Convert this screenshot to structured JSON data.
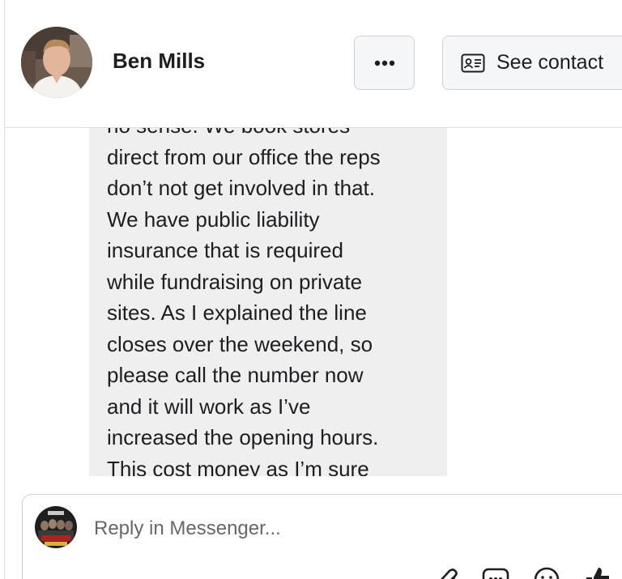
{
  "header": {
    "contact_name": "Ben Mills",
    "more_button_icon": "more-options-icon",
    "see_contact_label": "See contact",
    "see_contact_icon": "contact-card-icon"
  },
  "message": {
    "lines": [
      "no sense. We book stores",
      "direct from our office the reps",
      "don’t not get involved in that.",
      "We have public liability",
      "insurance that is required",
      "while fundraising on private",
      "sites. As I explained the line",
      "closes over the weekend, so",
      "please call the number now",
      "and it will work as I’ve",
      "increased the opening hours.",
      "This cost money as I’m sure"
    ],
    "bubble_color": "#efefef"
  },
  "reply": {
    "placeholder": "Reply in Messenger...",
    "value": "",
    "toolbar_icons": [
      "attach-icon",
      "gif-icon",
      "emoji-icon",
      "like-icon"
    ]
  },
  "colors": {
    "border": "#ced0d4",
    "text": "#1c1e21",
    "secondary_text": "#65676b"
  }
}
